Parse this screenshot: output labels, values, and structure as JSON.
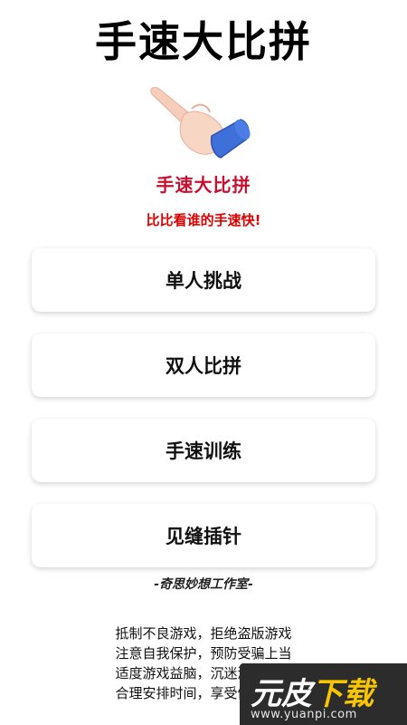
{
  "header": {
    "title": "手速大比拼"
  },
  "logo": {
    "icon": "pointing-hand-icon",
    "text": "手速大比拼"
  },
  "slogan": "比比看谁的手速快!",
  "menu": [
    {
      "label": "单人挑战"
    },
    {
      "label": "双人比拼"
    },
    {
      "label": "手速训练"
    },
    {
      "label": "见缝插针"
    }
  ],
  "studio": "-奇思妙想工作室-",
  "notice": {
    "line1": "抵制不良游戏，拒绝盗版游戏",
    "line2": "注意自我保护，预防受骗上当",
    "line3": "适度游戏益脑，沉迷游戏伤身",
    "line4": "合理安排时间，享受健康生活"
  },
  "watermark": {
    "logo_part1": "元皮",
    "logo_part2": "下载",
    "url": "www.yuanpi.com"
  },
  "colors": {
    "accent_red": "#e00000",
    "logo_red": "#c8102e",
    "sleeve_blue": "#3f6fd8",
    "watermark_yellow": "#f7c600"
  }
}
